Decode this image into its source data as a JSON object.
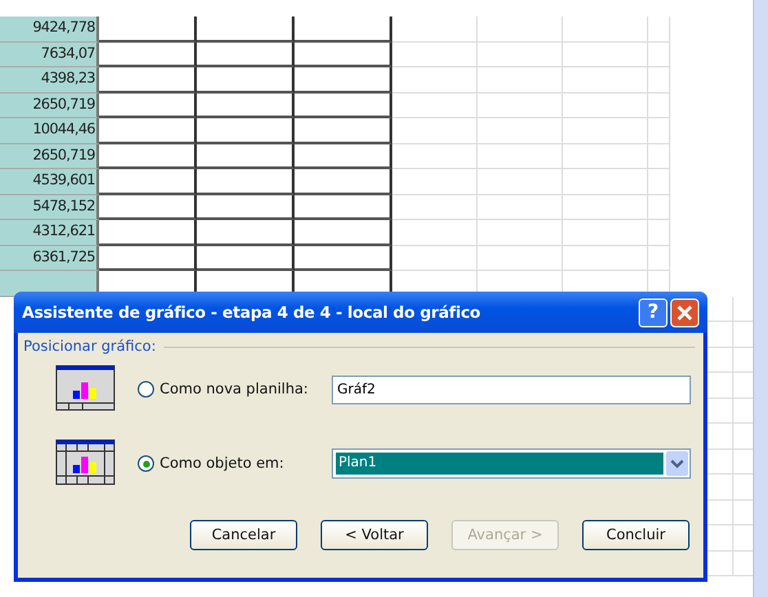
{
  "sheet": {
    "values": [
      "9424,778",
      "7634,07",
      "4398,23",
      "2650,719",
      "10044,46",
      "2650,719",
      "4539,601",
      "5478,152",
      "4312,621",
      "6361,725"
    ]
  },
  "dialog": {
    "title": "Assistente de gráfico - etapa 4 de 4 - local do gráfico",
    "help": "?",
    "section": "Posicionar gráfico:",
    "options": [
      {
        "label": "Como nova planilha:",
        "selected": false,
        "field": {
          "kind": "text",
          "value": "Gráf2"
        }
      },
      {
        "label": "Como objeto em:",
        "selected": true,
        "field": {
          "kind": "dropdown",
          "value": "Plan1"
        }
      }
    ],
    "buttons": [
      {
        "label": "Cancelar",
        "disabled": false
      },
      {
        "label": "< Voltar",
        "disabled": false
      },
      {
        "label": "Avançar >",
        "disabled": true
      },
      {
        "label": "Concluir",
        "disabled": false
      }
    ]
  }
}
